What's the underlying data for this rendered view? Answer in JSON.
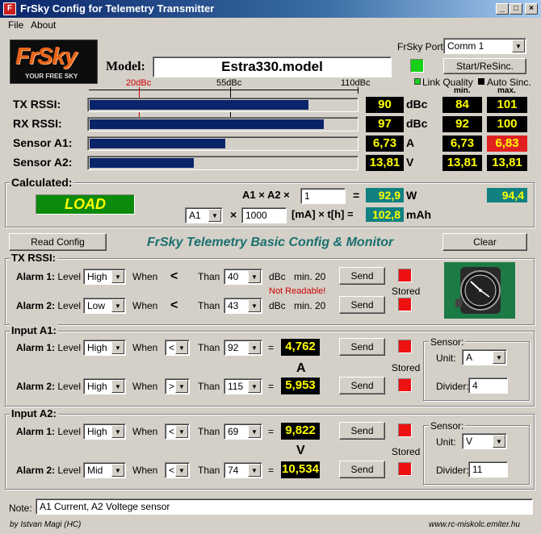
{
  "window": {
    "title": "FrSky Config for Telemetry Transmitter",
    "minimize": "_",
    "maximize": "□",
    "close": "×",
    "app_icon": "frsky-app-icon"
  },
  "menu": {
    "file": "File",
    "about": "About"
  },
  "logo": {
    "brand": "FrSky",
    "tagline": "YOUR FREE SKY"
  },
  "model": {
    "label": "Model:",
    "value": "Estra330.model"
  },
  "port": {
    "label": "FrSky Port:",
    "value": "Comm  1",
    "resync_label": "Start/ReSinc."
  },
  "indicators": {
    "link_quality": "Link Quality",
    "auto_sinc": "Auto Sinc.",
    "min": "min.",
    "max": "max."
  },
  "scale": {
    "mark1": "20dBc",
    "mark2": "55dBc",
    "mark3": "110dBc"
  },
  "readings": [
    {
      "label": "TX RSSI:",
      "value": "90",
      "unit": "dBc",
      "min": "84",
      "max": "101",
      "level": 0.82,
      "max_red": false
    },
    {
      "label": "RX RSSI:",
      "value": "97",
      "unit": "dBc",
      "min": "92",
      "max": "100",
      "level": 0.88,
      "max_red": false
    },
    {
      "label": "Sensor A1:",
      "value": "6,73",
      "unit": "A",
      "min": "6,73",
      "max": "6,83",
      "level": 0.51,
      "max_red": true
    },
    {
      "label": "Sensor A2:",
      "value": "13,81",
      "unit": "V",
      "min": "13,81",
      "max": "13,81",
      "level": 0.39,
      "max_red": false
    }
  ],
  "calculated": {
    "title": "Calculated:",
    "load_label": "LOAD",
    "formula1": "A1 × A2 ×",
    "factor1": "1",
    "eq1": "=",
    "result1": "92,9",
    "unit1": "W",
    "peak": "94,4",
    "channel": "A1",
    "times": "×",
    "factor2": "1000",
    "formula2": "[mA] × t[h] =",
    "result2": "102,8",
    "unit2": "mAh"
  },
  "actions": {
    "read_config": "Read Config",
    "header_title": "FrSky Telemetry Basic Config & Monitor",
    "clear": "Clear"
  },
  "common": {
    "level": "Level",
    "when": "When",
    "than": "Than",
    "send": "Send",
    "stored": "Stored",
    "alarm1": "Alarm 1:",
    "alarm2": "Alarm 2:",
    "eq": "="
  },
  "tx_rssi": {
    "title": "TX RSSI:",
    "alarm1": {
      "level": "High",
      "op": "<",
      "than": "40",
      "unit": "dBc",
      "min": "min. 20"
    },
    "alarm2": {
      "level": "Low",
      "op": "<",
      "than": "43",
      "unit": "dBc",
      "min": "min. 20"
    },
    "not_readable": "Not Readable!"
  },
  "input_a1": {
    "title": "Input A1:",
    "alarm1": {
      "level": "High",
      "op": "<",
      "than": "92",
      "value": "4,762"
    },
    "alarm2": {
      "level": "High",
      "op": ">",
      "than": "115",
      "value": "5,953"
    },
    "unit": "A",
    "sensor": {
      "title": "Sensor:",
      "unit_label": "Unit:",
      "unit": "A",
      "divider_label": "Divider:",
      "divider": "4"
    }
  },
  "input_a2": {
    "title": "Input A2:",
    "alarm1": {
      "level": "High",
      "op": "<",
      "than": "69",
      "value": "9,822"
    },
    "alarm2": {
      "level": "Mid",
      "op": "<",
      "than": "74",
      "value": "10,534"
    },
    "unit": "V",
    "sensor": {
      "title": "Sensor:",
      "unit_label": "Unit:",
      "unit": "V",
      "divider_label": "Divider:",
      "divider": "11"
    }
  },
  "note": {
    "label": "Note:",
    "value": "A1 Current, A2 Voltege sensor"
  },
  "footer": {
    "author": "by Istvan Magi   (HC)",
    "url": "www.rc-miskolc.emiter.hu"
  },
  "colors": {
    "bar": "#0a246a",
    "display_bg": "#000000",
    "display_fg": "#ffff00",
    "alarm_red": "#ee1111",
    "link_green": "#18d018",
    "load_green": "#0c8a0c",
    "teal": "#108080"
  }
}
